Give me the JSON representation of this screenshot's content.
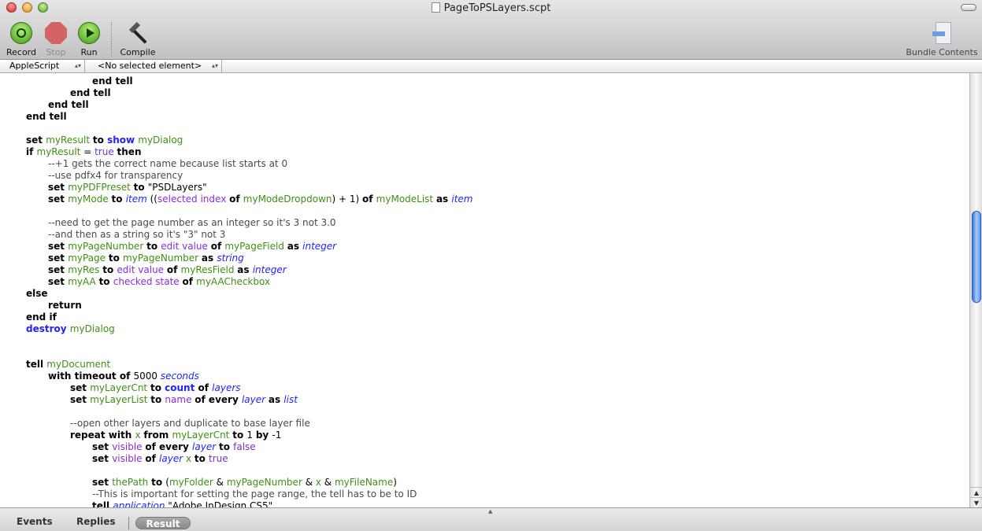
{
  "window": {
    "title": "PageToPSLayers.scpt"
  },
  "toolbar": {
    "record": "Record",
    "stop": "Stop",
    "run": "Run",
    "compile": "Compile",
    "bundle": "Bundle Contents"
  },
  "navbar": {
    "language": "AppleScript",
    "element": "<No selected element>"
  },
  "bottom": {
    "events": "Events",
    "replies": "Replies",
    "result": "Result"
  },
  "colors": {
    "keyword": "#000000",
    "variable": "#3f8f14",
    "command": "#2222ff",
    "class": "#2222ff",
    "property": "#8a2be2",
    "comment": "#4a4a4a"
  },
  "code": [
    {
      "i": 3,
      "t": [
        [
          "k",
          "end tell"
        ]
      ]
    },
    {
      "i": 2,
      "t": [
        [
          "k",
          "end tell"
        ]
      ]
    },
    {
      "i": 1,
      "t": [
        [
          "k",
          "end tell"
        ]
      ]
    },
    {
      "i": 0,
      "t": [
        [
          "k",
          "end tell"
        ]
      ]
    },
    {
      "i": 0,
      "t": []
    },
    {
      "i": 0,
      "t": [
        [
          "k",
          "set "
        ],
        [
          "v",
          "myResult "
        ],
        [
          "k",
          "to "
        ],
        [
          "c",
          "show "
        ],
        [
          "v",
          "myDialog"
        ]
      ]
    },
    {
      "i": 0,
      "t": [
        [
          "k",
          "if "
        ],
        [
          "v",
          "myResult "
        ],
        [
          "t",
          "= "
        ],
        [
          "n",
          "true "
        ],
        [
          "k",
          "then"
        ]
      ]
    },
    {
      "i": 1,
      "t": [
        [
          "cm",
          "--+1 gets the correct name because list starts at 0"
        ]
      ]
    },
    {
      "i": 1,
      "t": [
        [
          "cm",
          "--use pdfx4 for transparency"
        ]
      ]
    },
    {
      "i": 1,
      "t": [
        [
          "k",
          "set "
        ],
        [
          "v",
          "myPDFPreset "
        ],
        [
          "k",
          "to "
        ],
        [
          "s",
          "\"PSDLayers\""
        ]
      ]
    },
    {
      "i": 1,
      "t": [
        [
          "k",
          "set "
        ],
        [
          "v",
          "myMode "
        ],
        [
          "k",
          "to "
        ],
        [
          "cl",
          "item "
        ],
        [
          "t",
          "(("
        ],
        [
          "p",
          "selected index "
        ],
        [
          "k",
          "of "
        ],
        [
          "v",
          "myModeDropdown"
        ],
        [
          "t",
          ") + 1) "
        ],
        [
          "k",
          "of "
        ],
        [
          "v",
          "myModeList "
        ],
        [
          "k",
          "as "
        ],
        [
          "cl",
          "item"
        ]
      ]
    },
    {
      "i": 0,
      "t": []
    },
    {
      "i": 1,
      "t": [
        [
          "cm",
          "--need to get the page number as an integer so it's 3 not 3.0"
        ]
      ]
    },
    {
      "i": 1,
      "t": [
        [
          "cm",
          "--and then as a string so it's \"3\" not 3"
        ]
      ]
    },
    {
      "i": 1,
      "t": [
        [
          "k",
          "set "
        ],
        [
          "v",
          "myPageNumber "
        ],
        [
          "k",
          "to "
        ],
        [
          "p",
          "edit value "
        ],
        [
          "k",
          "of "
        ],
        [
          "v",
          "myPageField "
        ],
        [
          "k",
          "as "
        ],
        [
          "cl",
          "integer"
        ]
      ]
    },
    {
      "i": 1,
      "t": [
        [
          "k",
          "set "
        ],
        [
          "v",
          "myPage "
        ],
        [
          "k",
          "to "
        ],
        [
          "v",
          "myPageNumber "
        ],
        [
          "k",
          "as "
        ],
        [
          "cl",
          "string"
        ]
      ]
    },
    {
      "i": 1,
      "t": [
        [
          "k",
          "set "
        ],
        [
          "v",
          "myRes "
        ],
        [
          "k",
          "to "
        ],
        [
          "p",
          "edit value "
        ],
        [
          "k",
          "of "
        ],
        [
          "v",
          "myResField "
        ],
        [
          "k",
          "as "
        ],
        [
          "cl",
          "integer"
        ]
      ]
    },
    {
      "i": 1,
      "t": [
        [
          "k",
          "set "
        ],
        [
          "v",
          "myAA "
        ],
        [
          "k",
          "to "
        ],
        [
          "p",
          "checked state "
        ],
        [
          "k",
          "of "
        ],
        [
          "v",
          "myAACheckbox"
        ]
      ]
    },
    {
      "i": 0,
      "t": [
        [
          "k",
          "else"
        ]
      ]
    },
    {
      "i": 1,
      "t": [
        [
          "k",
          "return"
        ]
      ]
    },
    {
      "i": 0,
      "t": [
        [
          "k",
          "end if"
        ]
      ]
    },
    {
      "i": 0,
      "t": [
        [
          "c",
          "destroy "
        ],
        [
          "v",
          "myDialog"
        ]
      ]
    },
    {
      "i": 0,
      "t": []
    },
    {
      "i": 0,
      "t": []
    },
    {
      "i": 0,
      "t": [
        [
          "k",
          "tell "
        ],
        [
          "v",
          "myDocument"
        ]
      ]
    },
    {
      "i": 1,
      "t": [
        [
          "k",
          "with timeout of "
        ],
        [
          "t",
          "5000 "
        ],
        [
          "cl",
          "seconds"
        ]
      ]
    },
    {
      "i": 2,
      "t": [
        [
          "k",
          "set "
        ],
        [
          "v",
          "myLayerCnt "
        ],
        [
          "k",
          "to "
        ],
        [
          "c",
          "count "
        ],
        [
          "k",
          "of "
        ],
        [
          "cl",
          "layers"
        ]
      ]
    },
    {
      "i": 2,
      "t": [
        [
          "k",
          "set "
        ],
        [
          "v",
          "myLayerList "
        ],
        [
          "k",
          "to "
        ],
        [
          "p",
          "name "
        ],
        [
          "k",
          "of every "
        ],
        [
          "cl",
          "layer "
        ],
        [
          "k",
          "as "
        ],
        [
          "cl",
          "list"
        ]
      ]
    },
    {
      "i": 0,
      "t": []
    },
    {
      "i": 2,
      "t": [
        [
          "cm",
          "--open other layers and duplicate to base layer file"
        ]
      ]
    },
    {
      "i": 2,
      "t": [
        [
          "k",
          "repeat with "
        ],
        [
          "v",
          "x "
        ],
        [
          "k",
          "from "
        ],
        [
          "v",
          "myLayerCnt "
        ],
        [
          "k",
          "to "
        ],
        [
          "t",
          "1 "
        ],
        [
          "k",
          "by "
        ],
        [
          "t",
          "-1"
        ]
      ]
    },
    {
      "i": 3,
      "t": [
        [
          "k",
          "set "
        ],
        [
          "p",
          "visible "
        ],
        [
          "k",
          "of every "
        ],
        [
          "cl",
          "layer "
        ],
        [
          "k",
          "to "
        ],
        [
          "n",
          "false"
        ]
      ]
    },
    {
      "i": 3,
      "t": [
        [
          "k",
          "set "
        ],
        [
          "p",
          "visible "
        ],
        [
          "k",
          "of "
        ],
        [
          "cl",
          "layer "
        ],
        [
          "v",
          "x "
        ],
        [
          "k",
          "to "
        ],
        [
          "n",
          "true"
        ]
      ]
    },
    {
      "i": 0,
      "t": []
    },
    {
      "i": 3,
      "t": [
        [
          "k",
          "set "
        ],
        [
          "v",
          "thePath "
        ],
        [
          "k",
          "to "
        ],
        [
          "t",
          "("
        ],
        [
          "v",
          "myFolder "
        ],
        [
          "t",
          "& "
        ],
        [
          "v",
          "myPageNumber "
        ],
        [
          "t",
          "& "
        ],
        [
          "v",
          "x "
        ],
        [
          "t",
          "& "
        ],
        [
          "v",
          "myFileName"
        ],
        [
          "t",
          ")"
        ]
      ]
    },
    {
      "i": 3,
      "t": [
        [
          "cm",
          "--This is important for setting the page range, the tell has to be to ID"
        ]
      ]
    },
    {
      "i": 3,
      "t": [
        [
          "k",
          "tell "
        ],
        [
          "cl",
          "application "
        ],
        [
          "s",
          "\"Adobe InDesign CS5\""
        ]
      ]
    }
  ]
}
